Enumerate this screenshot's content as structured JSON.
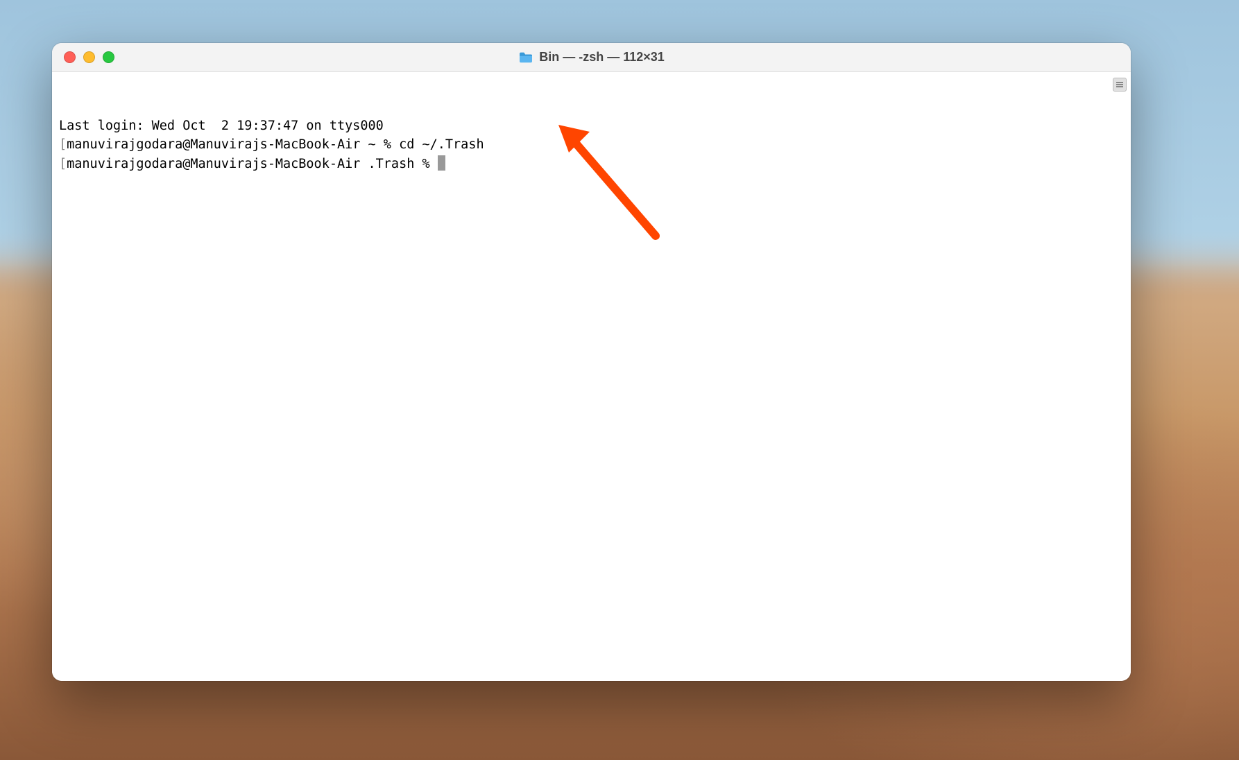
{
  "window": {
    "title": "Bin — -zsh — 112×31"
  },
  "terminal": {
    "lines": {
      "last_login": "Last login: Wed Oct  2 19:37:47 on ttys000",
      "line1_bracket_open": "[",
      "line1_prompt": "manuvirajgodara@Manuvirajs-MacBook-Air ~ % ",
      "line1_command": "cd ~/.Trash",
      "line2_bracket_open": "[",
      "line2_prompt": "manuvirajgodara@Manuvirajs-MacBook-Air .Trash % "
    }
  },
  "annotation": {
    "arrow_color": "#ff4500"
  }
}
